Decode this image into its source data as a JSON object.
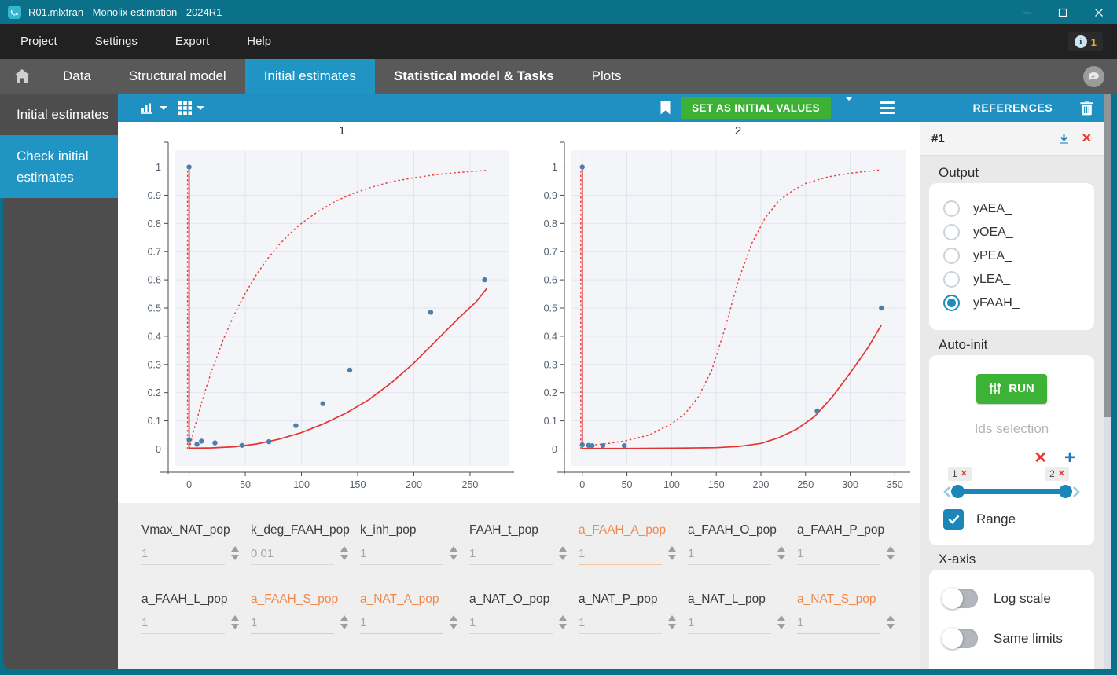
{
  "window": {
    "title": "R01.mlxtran - Monolix estimation - 2024R1"
  },
  "menu": {
    "items": [
      "Project",
      "Settings",
      "Export",
      "Help"
    ],
    "info_count": "1"
  },
  "tabs": {
    "items": [
      {
        "label": "Data",
        "active": false,
        "bold": false
      },
      {
        "label": "Structural model",
        "active": false,
        "bold": false
      },
      {
        "label": "Initial estimates",
        "active": true,
        "bold": false
      },
      {
        "label": "Statistical model & Tasks",
        "active": false,
        "bold": true
      },
      {
        "label": "Plots",
        "active": false,
        "bold": false
      }
    ]
  },
  "sidebar": {
    "items": [
      {
        "label": "Initial estimates",
        "active": false
      },
      {
        "label": "Check initial estimates",
        "active": true
      }
    ]
  },
  "toolbar": {
    "set_initial_label": "SET AS INITIAL VALUES"
  },
  "references": {
    "title": "REFERENCES",
    "item_label": "#1"
  },
  "output_panel": {
    "title": "Output",
    "options": [
      "yAEA_",
      "yOEA_",
      "yPEA_",
      "yLEA_",
      "yFAAH_"
    ],
    "selected": "yFAAH_"
  },
  "autoinit": {
    "title": "Auto-init",
    "run_label": "RUN",
    "ids_label": "Ids selection",
    "range_label": "Range",
    "slider": {
      "left_chip": "1",
      "right_chip": "2"
    }
  },
  "xaxis_panel": {
    "title": "X-axis",
    "toggles": [
      {
        "label": "Log scale",
        "on": false
      },
      {
        "label": "Same limits",
        "on": false
      }
    ]
  },
  "parameters": {
    "rows": [
      [
        {
          "name": "Vmax_NAT_pop",
          "value": "1",
          "highlight": false
        },
        {
          "name": "k_deg_FAAH_pop",
          "value": "0.01",
          "highlight": false
        },
        {
          "name": "k_inh_pop",
          "value": "1",
          "highlight": false
        },
        {
          "name": "FAAH_t_pop",
          "value": "1",
          "highlight": false
        },
        {
          "name": "a_FAAH_A_pop",
          "value": "1",
          "highlight": true
        },
        {
          "name": "a_FAAH_O_pop",
          "value": "1",
          "highlight": false
        },
        {
          "name": "a_FAAH_P_pop",
          "value": "1",
          "highlight": false
        }
      ],
      [
        {
          "name": "a_FAAH_L_pop",
          "value": "1",
          "highlight": false
        },
        {
          "name": "a_FAAH_S_pop",
          "value": "1",
          "highlight": true
        },
        {
          "name": "a_NAT_A_pop",
          "value": "1",
          "highlight": true
        },
        {
          "name": "a_NAT_O_pop",
          "value": "1",
          "highlight": false
        },
        {
          "name": "a_NAT_P_pop",
          "value": "1",
          "highlight": false
        },
        {
          "name": "a_NAT_L_pop",
          "value": "1",
          "highlight": false
        },
        {
          "name": "a_NAT_S_pop",
          "value": "1",
          "highlight": true
        }
      ]
    ]
  },
  "chart_data": [
    {
      "type": "scatter",
      "title": "1",
      "xlabel": "",
      "ylabel": "",
      "xlim": [
        -13,
        285
      ],
      "ylim": [
        -0.06,
        1.06
      ],
      "x_ticks": [
        0,
        50,
        100,
        150,
        200,
        250
      ],
      "y_ticks": [
        0,
        0.1,
        0.2,
        0.3,
        0.4,
        0.5,
        0.6,
        0.7,
        0.8,
        0.9,
        1
      ],
      "grid": true,
      "vline": {
        "x": 0,
        "y0": 0,
        "y1": 1
      },
      "series": [
        {
          "name": "upper-bound-dotted",
          "style": "dotted",
          "points": [
            [
              0,
              0
            ],
            [
              5,
              0.077
            ],
            [
              10,
              0.149
            ],
            [
              15,
              0.215
            ],
            [
              20,
              0.276
            ],
            [
              30,
              0.384
            ],
            [
              40,
              0.476
            ],
            [
              50,
              0.553
            ],
            [
              60,
              0.619
            ],
            [
              70,
              0.676
            ],
            [
              80,
              0.724
            ],
            [
              90,
              0.765
            ],
            [
              100,
              0.8
            ],
            [
              115,
              0.843
            ],
            [
              130,
              0.878
            ],
            [
              145,
              0.905
            ],
            [
              160,
              0.926
            ],
            [
              180,
              0.948
            ],
            [
              200,
              0.962
            ],
            [
              220,
              0.973
            ],
            [
              240,
              0.981
            ],
            [
              265,
              0.988
            ]
          ]
        },
        {
          "name": "prediction-solid",
          "style": "solid",
          "points": [
            [
              0,
              0.003
            ],
            [
              20,
              0.004
            ],
            [
              40,
              0.008
            ],
            [
              60,
              0.018
            ],
            [
              80,
              0.035
            ],
            [
              100,
              0.058
            ],
            [
              120,
              0.09
            ],
            [
              140,
              0.128
            ],
            [
              160,
              0.175
            ],
            [
              180,
              0.235
            ],
            [
              200,
              0.305
            ],
            [
              220,
              0.385
            ],
            [
              240,
              0.465
            ],
            [
              255,
              0.52
            ],
            [
              265,
              0.57
            ]
          ]
        }
      ],
      "observations": [
        [
          0,
          1
        ],
        [
          0,
          0.033
        ],
        [
          7,
          0.017
        ],
        [
          11,
          0.028
        ],
        [
          23,
          0.022
        ],
        [
          47,
          0.013
        ],
        [
          71,
          0.026
        ],
        [
          95,
          0.083
        ],
        [
          119,
          0.161
        ],
        [
          143,
          0.28
        ],
        [
          215,
          0.485
        ],
        [
          263,
          0.6
        ]
      ]
    },
    {
      "type": "scatter",
      "title": "2",
      "xlabel": "",
      "ylabel": "",
      "xlim": [
        -13,
        362
      ],
      "ylim": [
        -0.06,
        1.06
      ],
      "x_ticks": [
        0,
        50,
        100,
        150,
        200,
        250,
        300,
        350
      ],
      "y_ticks": [
        0,
        0.1,
        0.2,
        0.3,
        0.4,
        0.5,
        0.6,
        0.7,
        0.8,
        0.9,
        1
      ],
      "grid": true,
      "vline": {
        "x": 0,
        "y0": 0,
        "y1": 1
      },
      "series": [
        {
          "name": "upper-bound-dotted",
          "style": "dotted",
          "points": [
            [
              0,
              0.012
            ],
            [
              25,
              0.018
            ],
            [
              50,
              0.03
            ],
            [
              75,
              0.05
            ],
            [
              100,
              0.09
            ],
            [
              115,
              0.125
            ],
            [
              130,
              0.185
            ],
            [
              145,
              0.28
            ],
            [
              160,
              0.43
            ],
            [
              175,
              0.6
            ],
            [
              190,
              0.73
            ],
            [
              205,
              0.82
            ],
            [
              220,
              0.88
            ],
            [
              235,
              0.915
            ],
            [
              250,
              0.942
            ],
            [
              275,
              0.965
            ],
            [
              300,
              0.978
            ],
            [
              320,
              0.985
            ],
            [
              335,
              0.99
            ]
          ]
        },
        {
          "name": "prediction-solid",
          "style": "solid",
          "points": [
            [
              0,
              0.002
            ],
            [
              50,
              0.002
            ],
            [
              100,
              0.003
            ],
            [
              150,
              0.005
            ],
            [
              175,
              0.009
            ],
            [
              200,
              0.02
            ],
            [
              220,
              0.04
            ],
            [
              240,
              0.07
            ],
            [
              260,
              0.115
            ],
            [
              280,
              0.185
            ],
            [
              300,
              0.27
            ],
            [
              320,
              0.36
            ],
            [
              335,
              0.44
            ]
          ]
        }
      ],
      "observations": [
        [
          0,
          1
        ],
        [
          0,
          0.015
        ],
        [
          7,
          0.013
        ],
        [
          11,
          0.012
        ],
        [
          23,
          0.012
        ],
        [
          47,
          0.012
        ],
        [
          263,
          0.135
        ],
        [
          335,
          0.5
        ]
      ]
    }
  ],
  "colors": {
    "accent_blue": "#2095c4",
    "teal": "#0b7089",
    "green": "#3db136",
    "orange": "#ee8a4e",
    "curve_red": "#e23531",
    "point_blue": "#4e7fa9"
  }
}
